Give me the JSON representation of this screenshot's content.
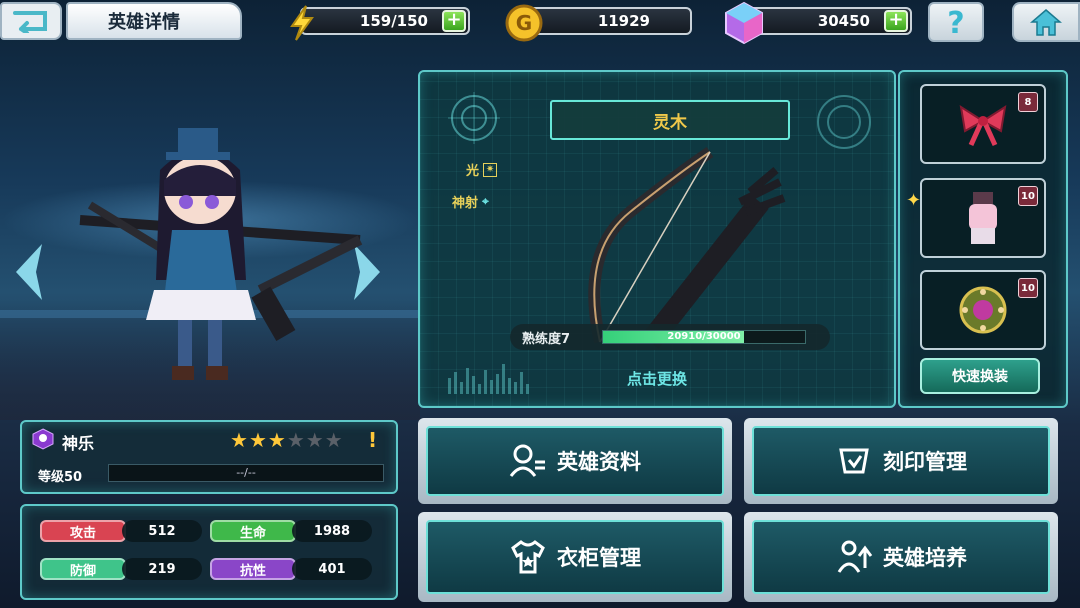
{
  "topbar": {
    "title": "英雄详情",
    "energy": "159/150",
    "gold": "11929",
    "gems": "30450"
  },
  "weapon": {
    "name": "灵木",
    "attr_light": "光",
    "attr_shoot": "神射",
    "proficiency_label": "熟练度7",
    "proficiency_value": "20910/30000",
    "proficiency_fraction": 0.697,
    "switch_label": "点击更换"
  },
  "equipment": {
    "slots": [
      {
        "icon": "bow-ribbon-icon",
        "level": "8"
      },
      {
        "icon": "costume-icon",
        "level": "10"
      },
      {
        "icon": "badge-icon",
        "level": "10"
      }
    ],
    "quick_swap_label": "快速换装"
  },
  "hero": {
    "name": "神乐",
    "level_label": "等级50",
    "exp_text": "--/--",
    "stars_filled": 3,
    "stars_total": 6
  },
  "stats": {
    "attack_label": "攻击",
    "attack_value": "512",
    "hp_label": "生命",
    "hp_value": "1988",
    "defense_label": "防御",
    "defense_value": "219",
    "resist_label": "抗性",
    "resist_value": "401"
  },
  "menu": {
    "hero_info": "英雄资料",
    "engrave": "刻印管理",
    "wardrobe": "衣柜管理",
    "training": "英雄培养"
  },
  "colors": {
    "accent": "#5ec9c9",
    "gold_text": "#f0c94a",
    "attack": "#d94452",
    "hp": "#3fb84a",
    "defense": "#3fc48a",
    "resist": "#8a46c8"
  }
}
